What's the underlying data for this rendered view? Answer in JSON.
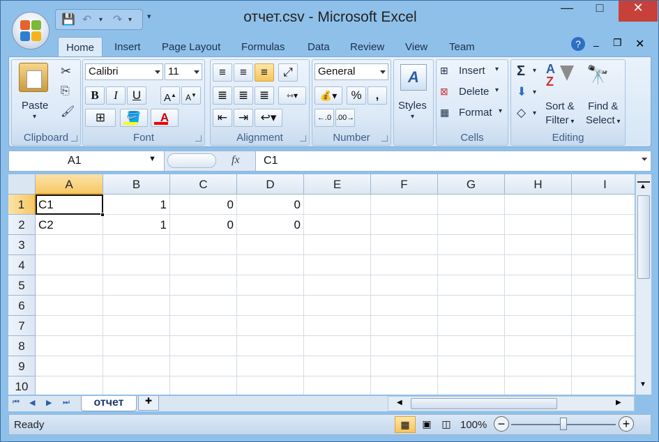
{
  "window": {
    "title": "отчет.csv - Microsoft Excel",
    "controls": {
      "minimize": "—",
      "maximize": "□",
      "close": "✕"
    }
  },
  "ribbon_tabs": [
    "Home",
    "Insert",
    "Page Layout",
    "Formulas",
    "Data",
    "Review",
    "View",
    "Team"
  ],
  "active_tab": "Home",
  "groups": {
    "clipboard": {
      "label": "Clipboard",
      "paste": "Paste"
    },
    "font": {
      "label": "Font",
      "font_name": "Calibri",
      "font_size": "11",
      "bold": "B",
      "italic": "I",
      "underline": "U"
    },
    "alignment": {
      "label": "Alignment"
    },
    "number": {
      "label": "Number",
      "format": "General",
      "percent": "%",
      "comma": ","
    },
    "styles": {
      "label": "Styles"
    },
    "cells": {
      "label": "Cells",
      "insert": "Insert",
      "delete": "Delete",
      "format": "Format"
    },
    "editing": {
      "label": "Editing",
      "sort_filter_1": "Sort &",
      "sort_filter_2": "Filter",
      "find_select_1": "Find &",
      "find_select_2": "Select"
    }
  },
  "formula_bar": {
    "name_box": "A1",
    "fx": "fx",
    "value": "C1"
  },
  "columns": [
    "A",
    "B",
    "C",
    "D",
    "E",
    "F",
    "G",
    "H",
    "I"
  ],
  "rows": [
    "1",
    "2",
    "3",
    "4",
    "5",
    "6",
    "7",
    "8",
    "9",
    "10"
  ],
  "cells": {
    "r1": [
      "C1",
      "1",
      "0",
      "0"
    ],
    "r2": [
      "C2",
      "1",
      "0",
      "0"
    ]
  },
  "sheet": {
    "name": "отчет"
  },
  "status": {
    "ready": "Ready",
    "zoom": "100%"
  },
  "colors": {
    "accent": "#8ec0ea",
    "selected_header": "#f7c766",
    "close_button": "#c7413a"
  }
}
